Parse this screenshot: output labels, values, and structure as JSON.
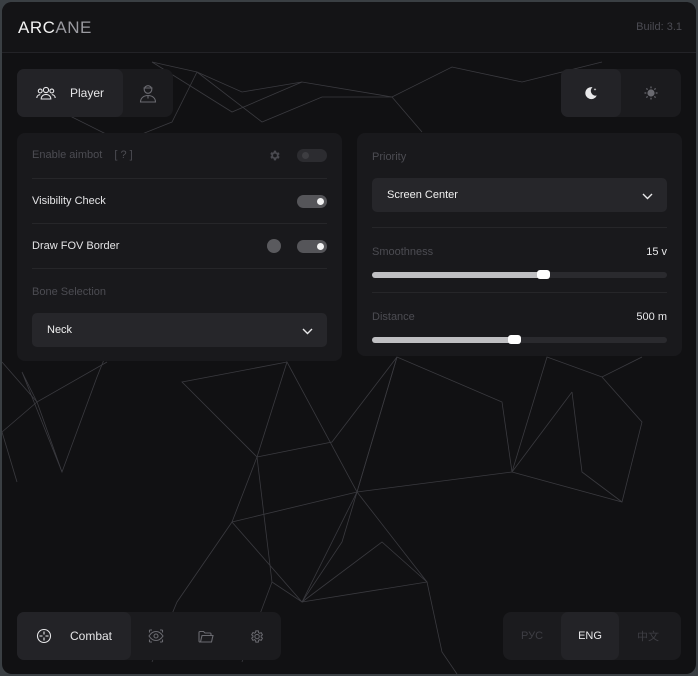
{
  "app": {
    "logo_bright": "ARC",
    "logo_dim": "ANE",
    "build": "Build: 3.1"
  },
  "topnav": {
    "tabs": [
      {
        "label": "Player",
        "icon": "users-icon",
        "active": true
      },
      {
        "label": "",
        "icon": "user-icon",
        "active": false
      }
    ],
    "theme": [
      {
        "icon": "moon-icon",
        "active": true
      },
      {
        "icon": "sun-icon",
        "active": false
      }
    ]
  },
  "left_panel": {
    "enable_aimbot": {
      "label": "Enable aimbot",
      "hint": "[ ? ]",
      "on": false
    },
    "visibility_check": {
      "label": "Visibility Check",
      "on": true
    },
    "draw_fov_border": {
      "label": "Draw FOV Border",
      "on": true,
      "color": "#5a5a5e"
    },
    "bone_selection": {
      "label": "Bone Selection",
      "value": "Neck"
    }
  },
  "right_panel": {
    "priority": {
      "label": "Priority",
      "value": "Screen Center"
    },
    "smoothness": {
      "label": "Smoothness",
      "value_text": "15 v",
      "fraction": 0.58
    },
    "distance": {
      "label": "Distance",
      "value_text": "500 m",
      "fraction": 0.48
    }
  },
  "bottomnav": {
    "tabs": [
      {
        "label": "Combat",
        "icon": "crosshair-icon",
        "active": true
      },
      {
        "label": "",
        "icon": "eye-icon",
        "active": false
      },
      {
        "label": "",
        "icon": "folder-icon",
        "active": false
      },
      {
        "label": "",
        "icon": "gear-icon",
        "active": false
      }
    ],
    "languages": [
      {
        "label": "РУС",
        "active": false
      },
      {
        "label": "ENG",
        "active": true
      },
      {
        "label": "中文",
        "active": false
      }
    ]
  },
  "colors": {
    "background": "#111113",
    "panel": "#19191c",
    "accent": "#f3f3f3",
    "muted_text": "#4c4c52"
  }
}
